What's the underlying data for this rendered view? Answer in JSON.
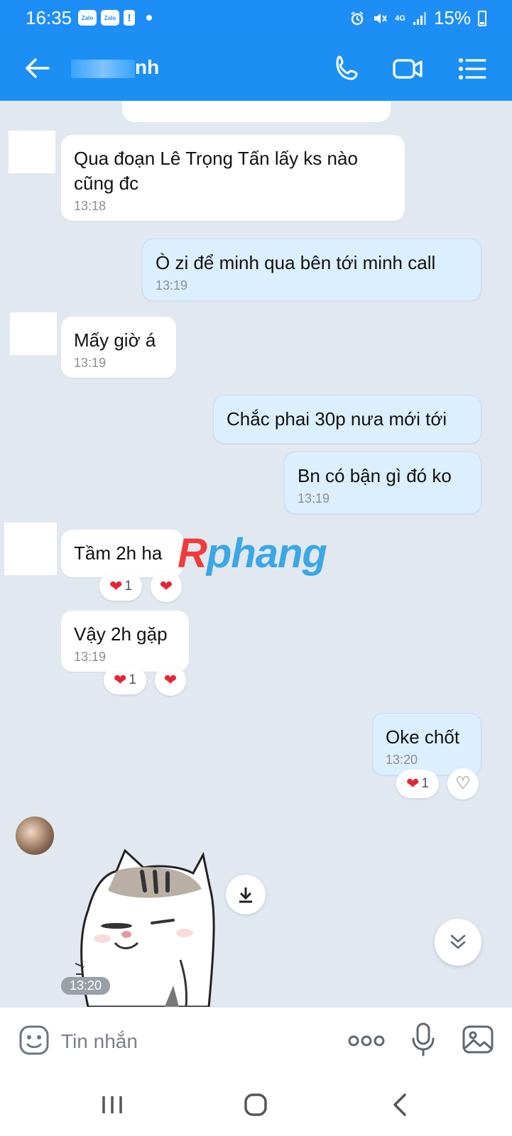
{
  "status_bar": {
    "time": "16:35",
    "notif_badges": [
      "Zalo",
      "Zalo"
    ],
    "alert_badge": "!",
    "network": "4G",
    "battery": "15%"
  },
  "header": {
    "contact_name_suffix": "nh",
    "icons": [
      "back-arrow-icon",
      "phone-icon",
      "video-call-icon",
      "menu-list-icon"
    ]
  },
  "messages": [
    {
      "id": "m1",
      "dir": "in",
      "text": "Qua đoạn Lê Trọng Tấn lấy ks nào cũng đc",
      "time": "13:18"
    },
    {
      "id": "m2",
      "dir": "out",
      "text": "Ò zi để minh qua bên tới minh call",
      "time": "13:19"
    },
    {
      "id": "m3",
      "dir": "in",
      "text": "Mấy giờ á",
      "time": "13:19"
    },
    {
      "id": "m4",
      "dir": "out",
      "text": "Chắc phai 30p nưa mới tới",
      "time": ""
    },
    {
      "id": "m5",
      "dir": "out",
      "text": "Bn có bận gì đó ko",
      "time": "13:19"
    },
    {
      "id": "m6",
      "dir": "in",
      "text": "Tầm 2h ha",
      "time": "",
      "reaction_count": "1"
    },
    {
      "id": "m7",
      "dir": "in",
      "text": "Vậy 2h gặp",
      "time": "13:19",
      "reaction_count": "1"
    },
    {
      "id": "m8",
      "dir": "out",
      "text": "Oke chốt",
      "time": "13:20",
      "reaction_count": "1"
    }
  ],
  "sticker": {
    "time": "13:20",
    "icon": "cat-sticker"
  },
  "watermark": {
    "first": "R",
    "rest": "phang"
  },
  "composer": {
    "placeholder": "Tin nhắn",
    "icons": [
      "emoji-icon",
      "more-options-icon",
      "microphone-icon",
      "image-icon"
    ]
  },
  "colors": {
    "header_blue": "#1c8ff5",
    "outgoing_bubble": "#dcefff",
    "incoming_bubble": "#ffffff",
    "chat_background": "#e2e8f0",
    "heart": "#e32636"
  }
}
